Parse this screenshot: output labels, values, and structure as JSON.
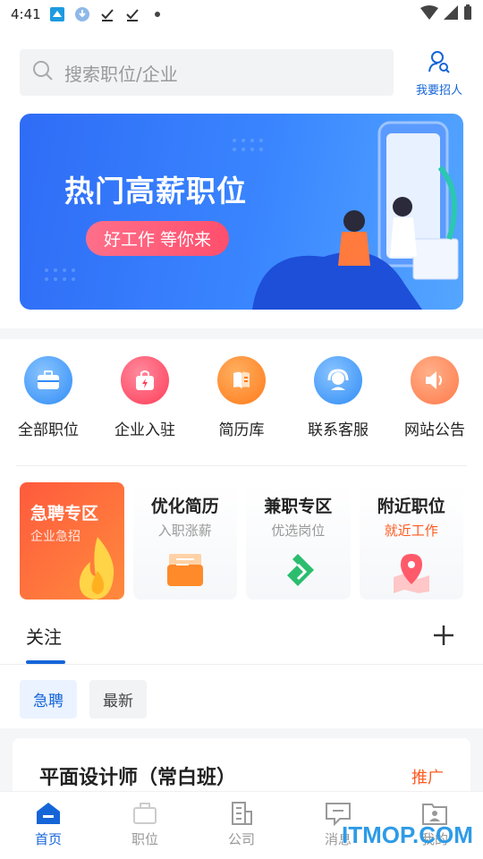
{
  "status_bar": {
    "time": "4:41"
  },
  "search": {
    "placeholder": "搜索职位/企业"
  },
  "header": {
    "recruit_label": "我要招人"
  },
  "banner": {
    "title": "热门高薪职位",
    "subtitle": "好工作 等你来"
  },
  "quick_nav": [
    {
      "label": "全部职位",
      "icon": "briefcase-icon",
      "color": "#2f8cf6"
    },
    {
      "label": "企业入驻",
      "icon": "bag-icon",
      "color": "#ff3d5a"
    },
    {
      "label": "简历库",
      "icon": "book-icon",
      "color": "#ff7a1a"
    },
    {
      "label": "联系客服",
      "icon": "headset-icon",
      "color": "#2f8cf6"
    },
    {
      "label": "网站公告",
      "icon": "speaker-icon",
      "color": "#ff7a4a"
    }
  ],
  "features": [
    {
      "title": "急聘专区",
      "subtitle": "企业急招",
      "icon": "flame-icon"
    },
    {
      "title": "优化简历",
      "subtitle": "入职涨薪",
      "icon": "envelope-icon"
    },
    {
      "title": "兼职专区",
      "subtitle": "优选岗位",
      "icon": "leaf-icon"
    },
    {
      "title": "附近职位",
      "subtitle": "就近工作",
      "icon": "map-pin-icon"
    }
  ],
  "follow": {
    "tab_label": "关注"
  },
  "chips": [
    "急聘",
    "最新"
  ],
  "job": {
    "title": "平面设计师（常白班）",
    "tag": "推广"
  },
  "bottom_nav": [
    {
      "label": "首页",
      "icon": "home-icon"
    },
    {
      "label": "职位",
      "icon": "briefcase-icon"
    },
    {
      "label": "公司",
      "icon": "building-icon"
    },
    {
      "label": "消息",
      "icon": "message-icon"
    },
    {
      "label": "我的",
      "icon": "profile-icon"
    }
  ],
  "watermark": "ITMOP.COM",
  "colors": {
    "accent": "#1565d8",
    "orange": "#ff5a1f"
  }
}
